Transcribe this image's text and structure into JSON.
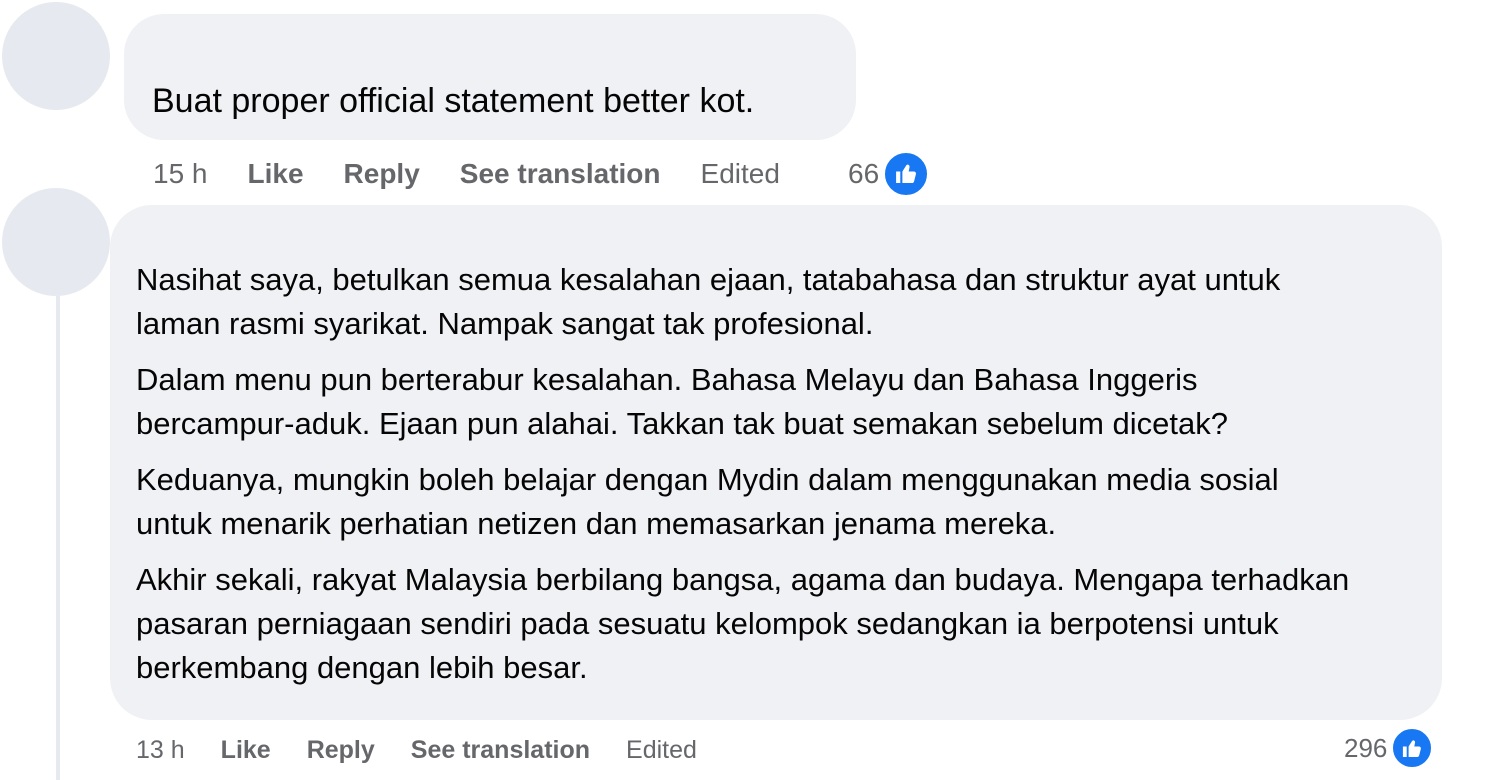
{
  "comments": [
    {
      "author": "",
      "text": "Buat proper official statement better kot.",
      "timestamp": "15 h",
      "like_label": "Like",
      "reply_label": "Reply",
      "translate_label": "See translation",
      "edited_label": "Edited",
      "reaction_count": "66",
      "reaction_icon": "thumbs-up-icon"
    },
    {
      "author": "",
      "paragraphs": [
        "Nasihat saya, betulkan semua kesalahan ejaan, tatabahasa dan struktur ayat untuk laman rasmi syarikat. Nampak sangat tak profesional.",
        "Dalam menu pun berterabur kesalahan. Bahasa Melayu dan Bahasa Inggeris bercampur-aduk. Ejaan pun alahai. Takkan tak buat semakan sebelum dicetak?",
        "Keduanya, mungkin boleh belajar dengan Mydin dalam menggunakan media sosial untuk menarik perhatian netizen dan memasarkan jenama mereka.",
        "Akhir sekali, rakyat Malaysia berbilang bangsa, agama dan budaya. Mengapa terhadkan pasaran perniagaan sendiri pada sesuatu kelompok sedangkan ia berpotensi untuk berkembang dengan lebih besar."
      ],
      "paragraph_lines": [
        [
          "Nasihat saya, betulkan semua kesalahan ejaan, tatabahasa dan struktur ayat untuk",
          "laman rasmi syarikat. Nampak sangat tak profesional."
        ],
        [
          "Dalam menu pun berterabur kesalahan. Bahasa Melayu dan Bahasa Inggeris",
          "bercampur-aduk. Ejaan pun alahai. Takkan tak buat semakan sebelum dicetak?"
        ],
        [
          "Keduanya, mungkin boleh belajar dengan Mydin dalam menggunakan media sosial",
          "untuk menarik perhatian netizen dan memasarkan jenama mereka."
        ],
        [
          "Akhir sekali, rakyat Malaysia berbilang bangsa, agama dan budaya. Mengapa terhadkan",
          "pasaran perniagaan sendiri pada sesuatu kelompok sedangkan ia berpotensi untuk",
          "berkembang dengan lebih besar."
        ]
      ],
      "timestamp": "13 h",
      "like_label": "Like",
      "reply_label": "Reply",
      "translate_label": "See translation",
      "edited_label": "Edited",
      "reaction_count": "296",
      "reaction_icon": "thumbs-up-icon"
    }
  ],
  "colors": {
    "bubble": "#f0f1f5",
    "avatar_placeholder": "#e6e9ef",
    "meta_text": "#65676b",
    "like_blue": "#1877f2"
  }
}
